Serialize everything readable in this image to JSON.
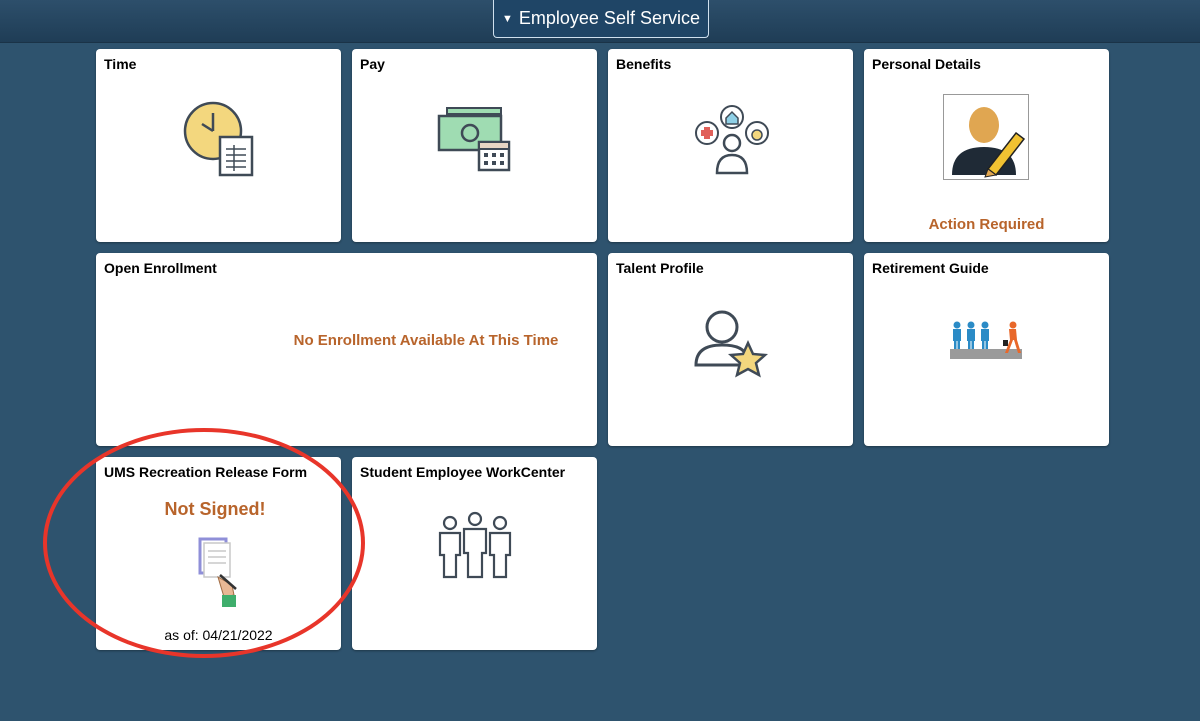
{
  "header": {
    "homepage_title": "Employee Self Service",
    "caret": "▼"
  },
  "tiles": {
    "time": {
      "title": "Time",
      "icon": "clock-timesheet-icon"
    },
    "pay": {
      "title": "Pay",
      "icon": "money-calendar-icon"
    },
    "benefits": {
      "title": "Benefits",
      "icon": "benefits-people-icon"
    },
    "personal_details": {
      "title": "Personal Details",
      "icon": "person-pencil-icon",
      "status": "Action Required"
    },
    "open_enrollment": {
      "title": "Open Enrollment",
      "status": "No Enrollment Available At This Time"
    },
    "talent_profile": {
      "title": "Talent Profile",
      "icon": "person-star-icon"
    },
    "retirement_guide": {
      "title": "Retirement Guide",
      "icon": "retirement-walk-icon"
    },
    "ums_recreation": {
      "title": "UMS Recreation Release Form",
      "status": "Not Signed!",
      "icon": "signing-document-icon",
      "as_of": "as of: 04/21/2022"
    },
    "student_workcenter": {
      "title": "Student Employee WorkCenter",
      "icon": "group-people-icon"
    }
  },
  "colors": {
    "background": "#2e536e",
    "status_orange": "#b8642b",
    "annotation_red": "#e8352a"
  }
}
